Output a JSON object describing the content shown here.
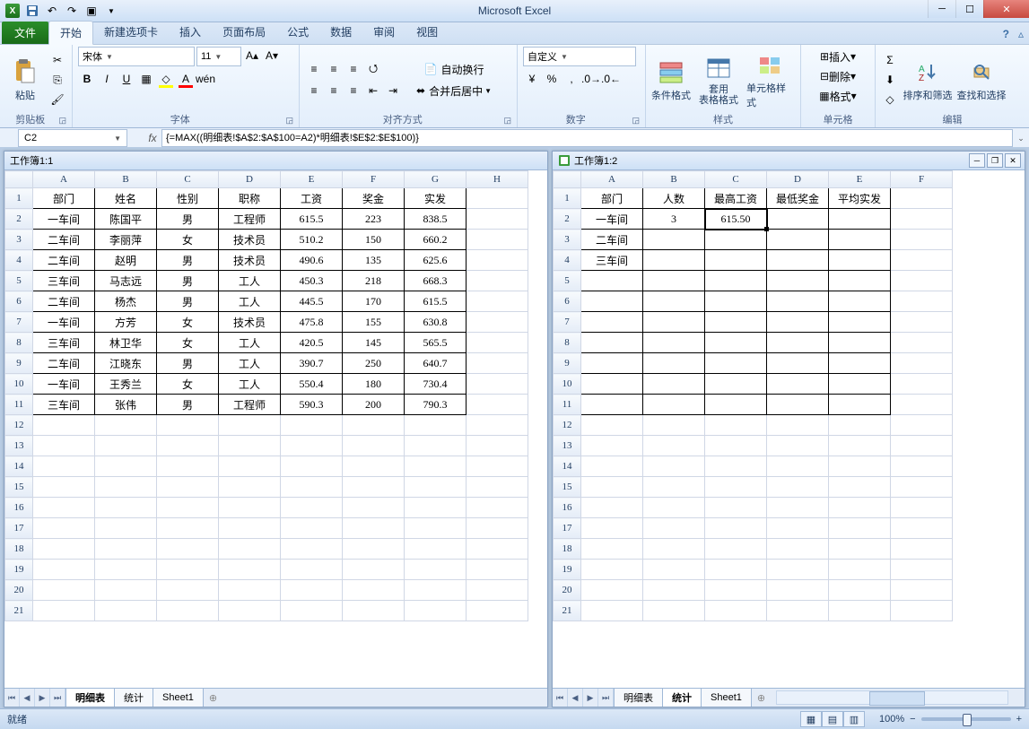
{
  "app_title": "Microsoft Excel",
  "ribbon": {
    "file": "文件",
    "tabs": [
      "开始",
      "新建选项卡",
      "插入",
      "页面布局",
      "公式",
      "数据",
      "审阅",
      "视图"
    ],
    "active_tab": "开始",
    "clipboard": {
      "label": "剪贴板",
      "paste": "粘贴"
    },
    "font": {
      "label": "字体",
      "name": "宋体",
      "size": "11"
    },
    "align": {
      "label": "对齐方式",
      "wrap": "自动换行",
      "merge": "合并后居中"
    },
    "number": {
      "label": "数字",
      "format": "自定义"
    },
    "styles": {
      "label": "样式",
      "cond": "条件格式",
      "table": "套用\n表格格式",
      "cell": "单元格样式"
    },
    "cells": {
      "label": "单元格",
      "insert": "插入",
      "delete": "删除",
      "format": "格式"
    },
    "editing": {
      "label": "编辑",
      "sort": "排序和筛选",
      "find": "查找和选择"
    }
  },
  "formula_bar": {
    "cell_ref": "C2",
    "formula": "{=MAX((明细表!$A$2:$A$100=A2)*明细表!$E$2:$E$100)}"
  },
  "window_left": {
    "title": "工作簿1:1",
    "cols": [
      "A",
      "B",
      "C",
      "D",
      "E",
      "F",
      "G",
      "H"
    ],
    "rows": 21,
    "header_row": [
      "部门",
      "姓名",
      "性别",
      "职称",
      "工资",
      "奖金",
      "实发"
    ],
    "data": [
      [
        "一车间",
        "陈国平",
        "男",
        "工程师",
        "615.5",
        "223",
        "838.5"
      ],
      [
        "二车间",
        "李丽萍",
        "女",
        "技术员",
        "510.2",
        "150",
        "660.2"
      ],
      [
        "二车间",
        "赵明",
        "男",
        "技术员",
        "490.6",
        "135",
        "625.6"
      ],
      [
        "三车间",
        "马志远",
        "男",
        "工人",
        "450.3",
        "218",
        "668.3"
      ],
      [
        "二车间",
        "杨杰",
        "男",
        "工人",
        "445.5",
        "170",
        "615.5"
      ],
      [
        "一车间",
        "方芳",
        "女",
        "技术员",
        "475.8",
        "155",
        "630.8"
      ],
      [
        "三车间",
        "林卫华",
        "女",
        "工人",
        "420.5",
        "145",
        "565.5"
      ],
      [
        "二车间",
        "江晓东",
        "男",
        "工人",
        "390.7",
        "250",
        "640.7"
      ],
      [
        "一车间",
        "王秀兰",
        "女",
        "工人",
        "550.4",
        "180",
        "730.4"
      ],
      [
        "三车间",
        "张伟",
        "男",
        "工程师",
        "590.3",
        "200",
        "790.3"
      ]
    ],
    "sheets": [
      "明细表",
      "统计",
      "Sheet1"
    ],
    "active_sheet": 0
  },
  "window_right": {
    "title": "工作簿1:2",
    "cols": [
      "A",
      "B",
      "C",
      "D",
      "E",
      "F"
    ],
    "rows": 21,
    "header_row": [
      "部门",
      "人数",
      "最高工资",
      "最低奖金",
      "平均实发"
    ],
    "data": [
      [
        "一车间",
        "3",
        "615.50",
        "",
        ""
      ],
      [
        "二车间",
        "",
        "",
        "",
        ""
      ],
      [
        "三车间",
        "",
        "",
        "",
        ""
      ]
    ],
    "selected_cell": {
      "row": 2,
      "col": 3
    },
    "sheets": [
      "明细表",
      "统计",
      "Sheet1"
    ],
    "active_sheet": 1
  },
  "statusbar": {
    "ready": "就绪",
    "zoom": "100%"
  }
}
